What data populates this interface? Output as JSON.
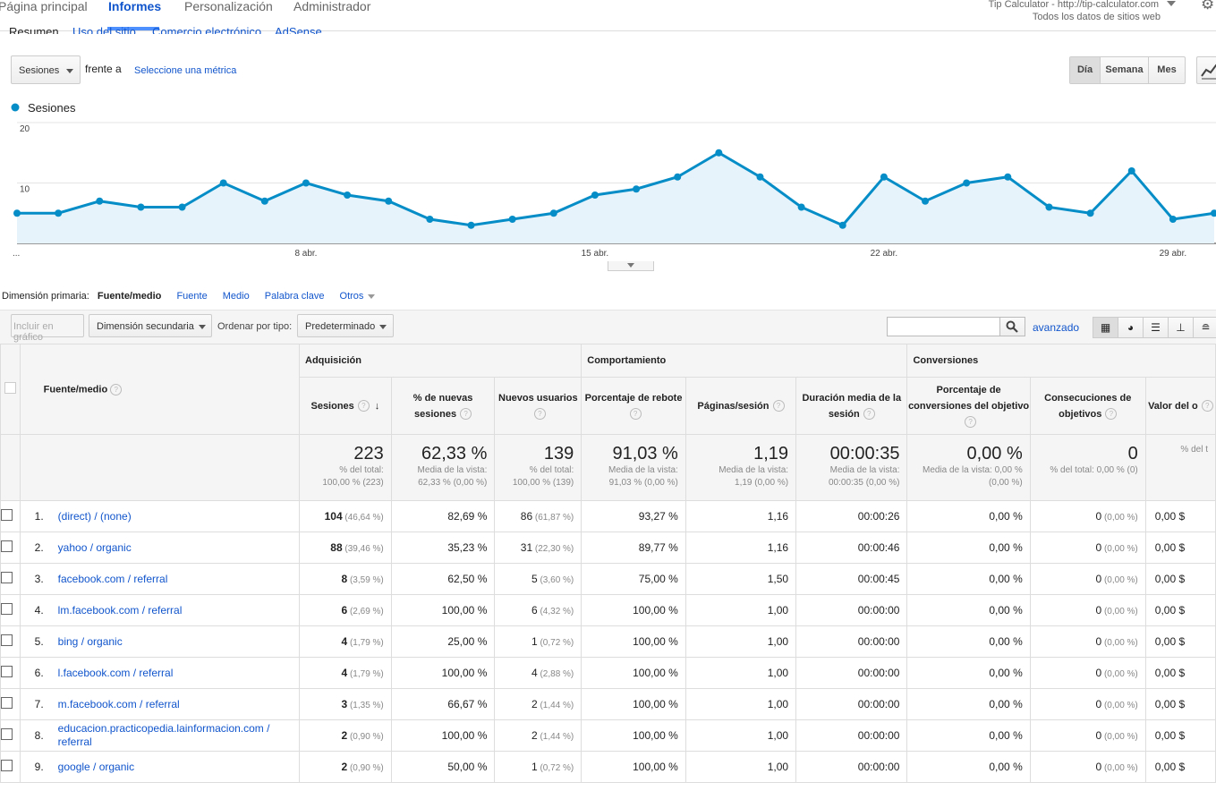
{
  "nav": {
    "items": [
      "Página principal",
      "Informes",
      "Personalización",
      "Administrador"
    ],
    "account_name": "Tip Calculator - http://tip-calculator.com",
    "account_view": "Todos los datos de sitios web"
  },
  "subtabs": [
    "Resumen",
    "Uso del sitio",
    "Comercio electrónico",
    "AdSense"
  ],
  "metric_controls": {
    "metric": "Sesiones",
    "versus": "frente a",
    "select_metric": "Seleccione una métrica",
    "periods": [
      "Día",
      "Semana",
      "Mes"
    ],
    "active_period": "Día"
  },
  "chart_data": {
    "type": "line",
    "legend": "Sesiones",
    "y_ticks": [
      "20",
      "10"
    ],
    "ylim": [
      0,
      20
    ],
    "x_ticks": [
      "...",
      "8 abr.",
      "15 abr.",
      "22 abr.",
      "29 abr."
    ],
    "values": [
      5,
      5,
      7,
      6,
      6,
      10,
      7,
      10,
      8,
      7,
      4,
      3,
      4,
      5,
      8,
      9,
      11,
      15,
      11,
      6,
      3,
      11,
      7,
      10,
      11,
      6,
      5,
      12,
      4,
      5
    ],
    "color": "#058dc7",
    "fill": "#e7f3fa"
  },
  "dimensions": {
    "label": "Dimensión primaria:",
    "active": "Fuente/medio",
    "options": [
      "Fuente",
      "Medio",
      "Palabra clave",
      "Otros"
    ]
  },
  "toolbar": {
    "include": "Incluir en gráfico",
    "secondary": "Dimensión secundaria",
    "sort_label": "Ordenar por tipo:",
    "sort_value": "Predeterminado",
    "advanced": "avanzado"
  },
  "table": {
    "groups": [
      "Adquisición",
      "Comportamiento",
      "Conversiones"
    ],
    "dim_header": "Fuente/medio",
    "headers": [
      "Sesiones",
      "% de nuevas sesiones",
      "Nuevos usuarios",
      "Porcentaje de rebote",
      "Páginas/sesión",
      "Duración media de la sesión",
      "Porcentaje de conversiones del objetivo",
      "Consecuciones de objetivos",
      "Valor del o"
    ],
    "totals": [
      {
        "big": "223",
        "sub1": "% del total:",
        "sub2": "100,00 % (223)"
      },
      {
        "big": "62,33 %",
        "sub1": "Media de la vista:",
        "sub2": "62,33 % (0,00 %)"
      },
      {
        "big": "139",
        "sub1": "% del total:",
        "sub2": "100,00 % (139)"
      },
      {
        "big": "91,03 %",
        "sub1": "Media de la vista:",
        "sub2": "91,03 % (0,00 %)"
      },
      {
        "big": "1,19",
        "sub1": "Media de la vista:",
        "sub2": "1,19 (0,00 %)"
      },
      {
        "big": "00:00:35",
        "sub1": "Media de la vista:",
        "sub2": "00:00:35 (0,00 %)"
      },
      {
        "big": "0,00 %",
        "sub1": "Media de la vista: 0,00 %",
        "sub2": "(0,00 %)"
      },
      {
        "big": "0",
        "sub1": "% del total: 0,00 % (0)",
        "sub2": ""
      },
      {
        "big": "",
        "sub1": "% del t",
        "sub2": ""
      }
    ],
    "rows": [
      {
        "n": "1.",
        "src": "(direct) / (none)",
        "s": "104",
        "sp": "(46,64 %)",
        "ns": "82,69 %",
        "nu": "86",
        "nup": "(61,87 %)",
        "br": "93,27 %",
        "pps": "1,16",
        "dur": "00:00:26",
        "conv": "0,00 %",
        "goal": "0",
        "goalp": "(0,00 %)",
        "val": "0,00 $"
      },
      {
        "n": "2.",
        "src": "yahoo / organic",
        "s": "88",
        "sp": "(39,46 %)",
        "ns": "35,23 %",
        "nu": "31",
        "nup": "(22,30 %)",
        "br": "89,77 %",
        "pps": "1,16",
        "dur": "00:00:46",
        "conv": "0,00 %",
        "goal": "0",
        "goalp": "(0,00 %)",
        "val": "0,00 $"
      },
      {
        "n": "3.",
        "src": "facebook.com / referral",
        "s": "8",
        "sp": "(3,59 %)",
        "ns": "62,50 %",
        "nu": "5",
        "nup": "(3,60 %)",
        "br": "75,00 %",
        "pps": "1,50",
        "dur": "00:00:45",
        "conv": "0,00 %",
        "goal": "0",
        "goalp": "(0,00 %)",
        "val": "0,00 $"
      },
      {
        "n": "4.",
        "src": "lm.facebook.com / referral",
        "s": "6",
        "sp": "(2,69 %)",
        "ns": "100,00 %",
        "nu": "6",
        "nup": "(4,32 %)",
        "br": "100,00 %",
        "pps": "1,00",
        "dur": "00:00:00",
        "conv": "0,00 %",
        "goal": "0",
        "goalp": "(0,00 %)",
        "val": "0,00 $"
      },
      {
        "n": "5.",
        "src": "bing / organic",
        "s": "4",
        "sp": "(1,79 %)",
        "ns": "25,00 %",
        "nu": "1",
        "nup": "(0,72 %)",
        "br": "100,00 %",
        "pps": "1,00",
        "dur": "00:00:00",
        "conv": "0,00 %",
        "goal": "0",
        "goalp": "(0,00 %)",
        "val": "0,00 $"
      },
      {
        "n": "6.",
        "src": "l.facebook.com / referral",
        "s": "4",
        "sp": "(1,79 %)",
        "ns": "100,00 %",
        "nu": "4",
        "nup": "(2,88 %)",
        "br": "100,00 %",
        "pps": "1,00",
        "dur": "00:00:00",
        "conv": "0,00 %",
        "goal": "0",
        "goalp": "(0,00 %)",
        "val": "0,00 $"
      },
      {
        "n": "7.",
        "src": "m.facebook.com / referral",
        "s": "3",
        "sp": "(1,35 %)",
        "ns": "66,67 %",
        "nu": "2",
        "nup": "(1,44 %)",
        "br": "100,00 %",
        "pps": "1,00",
        "dur": "00:00:00",
        "conv": "0,00 %",
        "goal": "0",
        "goalp": "(0,00 %)",
        "val": "0,00 $"
      },
      {
        "n": "8.",
        "src": "educacion.practicopedia.lainformacion.com / referral",
        "s": "2",
        "sp": "(0,90 %)",
        "ns": "100,00 %",
        "nu": "2",
        "nup": "(1,44 %)",
        "br": "100,00 %",
        "pps": "1,00",
        "dur": "00:00:00",
        "conv": "0,00 %",
        "goal": "0",
        "goalp": "(0,00 %)",
        "val": "0,00 $"
      },
      {
        "n": "9.",
        "src": "google / organic",
        "s": "2",
        "sp": "(0,90 %)",
        "ns": "50,00 %",
        "nu": "1",
        "nup": "(0,72 %)",
        "br": "100,00 %",
        "pps": "1,00",
        "dur": "00:00:00",
        "conv": "0,00 %",
        "goal": "0",
        "goalp": "(0,00 %)",
        "val": "0,00 $"
      }
    ]
  }
}
